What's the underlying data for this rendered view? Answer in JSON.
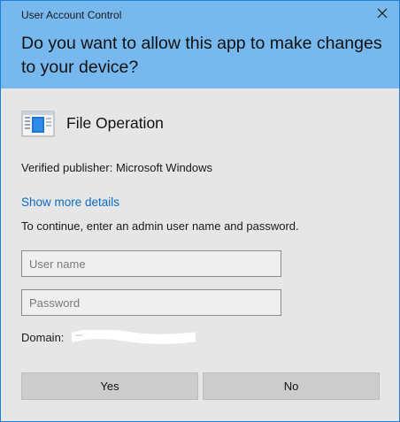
{
  "window": {
    "title": "User Account Control",
    "close_icon": "close-icon"
  },
  "header": {
    "question": "Do you want to allow this app to make changes to your device?"
  },
  "app": {
    "icon": "file-operation-icon",
    "name": "File Operation",
    "publisher": "Verified publisher: Microsoft Windows"
  },
  "details_link": "Show more details",
  "instruction": "To continue, enter an admin user name and password.",
  "username": {
    "placeholder": "User name",
    "value": ""
  },
  "password": {
    "placeholder": "Password",
    "value": ""
  },
  "domain": {
    "label": "Domain:",
    "value_redacted": true
  },
  "buttons": {
    "yes": "Yes",
    "no": "No"
  },
  "colors": {
    "header_bg": "#77b9ee",
    "body_bg": "#e6e6e6",
    "link": "#0a6cc6",
    "button_bg": "#cccccc",
    "border": "#1b7fd6"
  }
}
